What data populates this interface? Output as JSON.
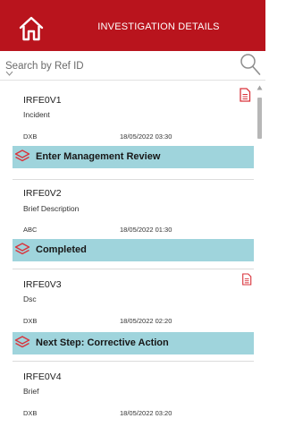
{
  "header": {
    "title": "INVESTIGATION DETAILS",
    "home_icon": "home-icon",
    "background_color": "#b9141d"
  },
  "search": {
    "placeholder": "Search by Ref ID",
    "icon": "search-icon"
  },
  "records": [
    {
      "ref_id": "IRFE0V1",
      "subtitle": "Incident",
      "code": "DXB",
      "datetime": "18/05/2022 03:30",
      "status": "Enter Management Review",
      "status_color": "#9fd4dc",
      "has_document_icon": true
    },
    {
      "ref_id": "IRFE0V2",
      "subtitle": "Brief Description",
      "code": "ABC",
      "datetime": "18/05/2022 01:30",
      "status": "Completed",
      "status_color": "#9fd4dc",
      "has_document_icon": false
    },
    {
      "ref_id": "IRFE0V3",
      "subtitle": "Dsc",
      "code": "DXB",
      "datetime": "18/05/2022 02:20",
      "status": "Next Step: Corrective Action",
      "status_color": "#9fd4dc",
      "has_document_icon": true
    },
    {
      "ref_id": "IRFE0V4",
      "subtitle": "Brief",
      "code": "DXB",
      "datetime": "18/05/2022 03:20",
      "status": "",
      "has_document_icon": false
    }
  ]
}
